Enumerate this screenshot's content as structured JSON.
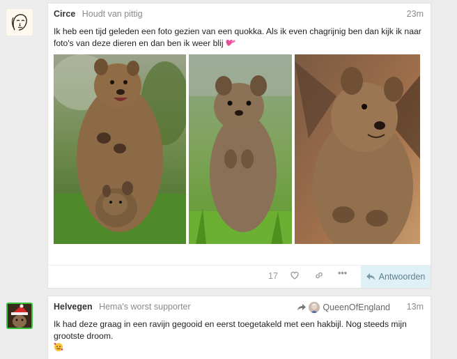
{
  "posts": [
    {
      "username": "Circe",
      "user_title": "Houdt van pittig",
      "time": "23m",
      "text": "Ik heb een tijd geleden een foto gezien van een quokka. Als ik even chagrijnig ben dan kijk ik naar foto's van deze dieren en dan ben ik weer blij",
      "like_count": "17",
      "reply_label": "Antwoorden",
      "avatar_icon": "line-art-face-avatar",
      "image_icons": [
        "quokka-photo-mother-joey",
        "quokka-photo-standing-grass",
        "quokka-photo-closeup"
      ]
    },
    {
      "username": "Helvegen",
      "user_title": "Hema's worst supporter",
      "reply_to_user": "QueenOfEngland",
      "time": "13m",
      "text": "Ik had deze graag in een ravijn gegooid en eerst toegetakeld met een hakbijl. Nog steeds mijn grootste droom.",
      "avatar_icon": "animal-santa-hat-avatar"
    }
  ],
  "colors": {
    "accent_reply_bg": "#dff0f7",
    "avatar_border_green": "#38c23a",
    "muted": "#8a8a8a"
  }
}
